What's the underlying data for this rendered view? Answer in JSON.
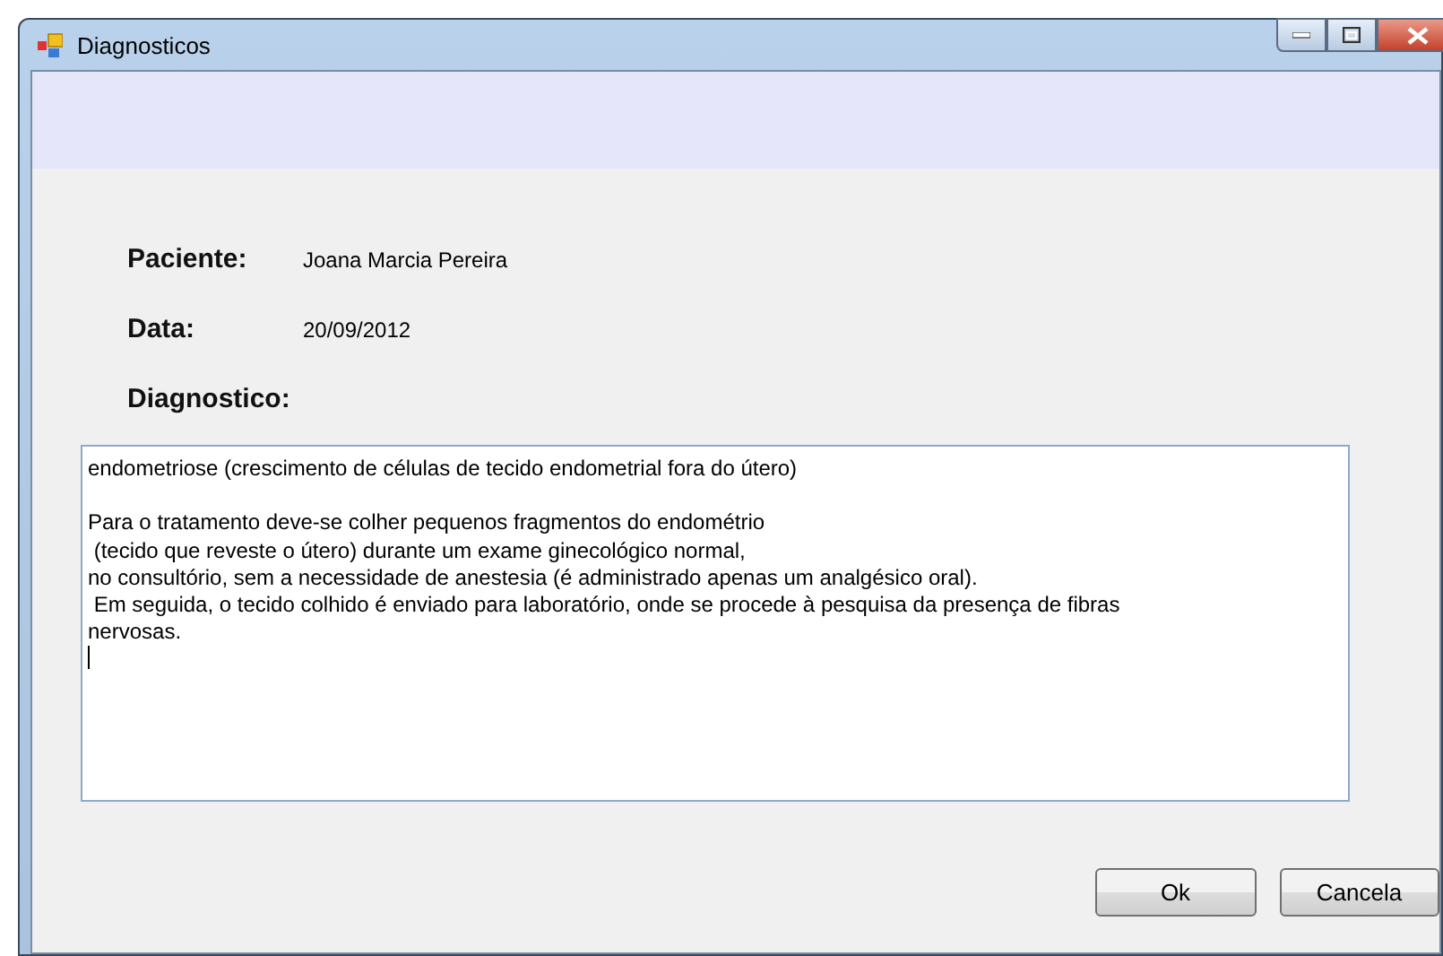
{
  "window": {
    "title": "Diagnosticos"
  },
  "fields": [
    {
      "label": "Paciente:",
      "value": "Joana Marcia Pereira"
    },
    {
      "label": "Data:",
      "value": "20/09/2012"
    }
  ],
  "diagnosis": {
    "label": "Diagnostico:",
    "value": "endometriose (crescimento de células de tecido endometrial fora do útero)\n\nPara o tratamento deve-se colher pequenos fragmentos do endométrio\n (tecido que reveste o útero) durante um exame ginecológico normal,\nno consultório, sem a necessidade de anestesia (é administrado apenas um analgésico oral).\n Em seguida, o tecido colhido é enviado para laboratório, onde se procede à pesquisa da presença de fibras\nnervosas.\n"
  },
  "buttons": [
    "Ok",
    "Cancela"
  ]
}
